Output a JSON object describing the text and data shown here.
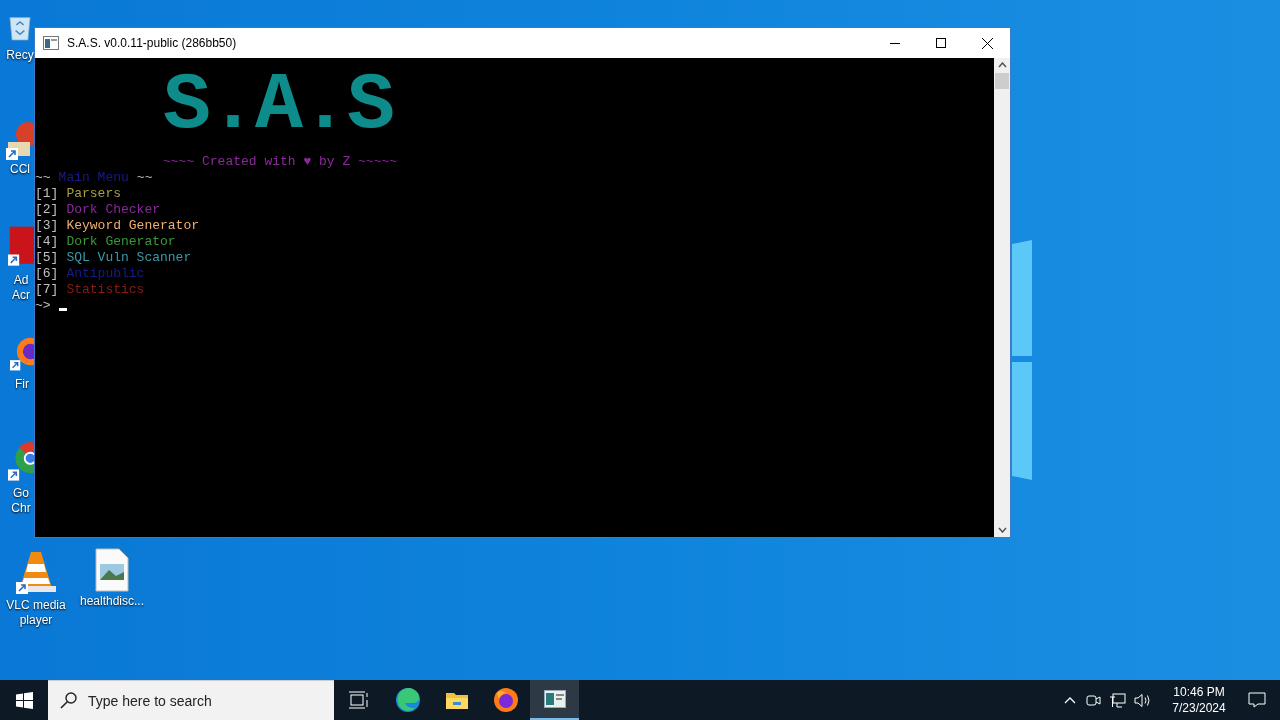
{
  "desktop_icons": [
    {
      "kind": "recycle",
      "label": "Recy"
    },
    {
      "kind": "ccleaner",
      "label": "CCl"
    },
    {
      "kind": "acrobat",
      "label": "Ad Acr"
    },
    {
      "kind": "firefox",
      "label": "Fir"
    },
    {
      "kind": "chrome",
      "label": "Go Chr"
    },
    {
      "kind": "vlc",
      "label": "VLC media player"
    },
    {
      "kind": "image-file",
      "label": "healthdisc..."
    }
  ],
  "window": {
    "title": "S.A.S. v0.0.11-public (286bb50)",
    "terminal": {
      "logo": "S.A.S",
      "credit": "~~~~ Created with ♥ by Z ~~~~~",
      "menu_title_left": "~~",
      "menu_title": "Main Menu",
      "menu_title_right": "~~",
      "items": [
        {
          "marker": "[1]",
          "label": "Parsers",
          "color": "#a8a040"
        },
        {
          "marker": "[2]",
          "label": "Dork Checker",
          "color": "#8a2a9a"
        },
        {
          "marker": "[3]",
          "label": "Keyword Generator",
          "color": "#f0b070"
        },
        {
          "marker": "[4]",
          "label": "Dork Generator",
          "color": "#3a9a3a"
        },
        {
          "marker": "[5]",
          "label": "SQL Vuln Scanner",
          "color": "#3a9aa8"
        },
        {
          "marker": "[6]",
          "label": "Antipublic",
          "color": "#1a1a8a"
        },
        {
          "marker": "[7]",
          "label": "Statistics",
          "color": "#8a1a1a"
        }
      ],
      "prompt": "~>"
    }
  },
  "taskbar": {
    "search_placeholder": "Type here to search",
    "apps": [
      {
        "kind": "task-view",
        "selected": false
      },
      {
        "kind": "edge",
        "selected": false
      },
      {
        "kind": "folder",
        "selected": false
      },
      {
        "kind": "firefox",
        "selected": false
      },
      {
        "kind": "console",
        "selected": true
      }
    ],
    "time": "10:46 PM",
    "date": "7/23/2024"
  }
}
